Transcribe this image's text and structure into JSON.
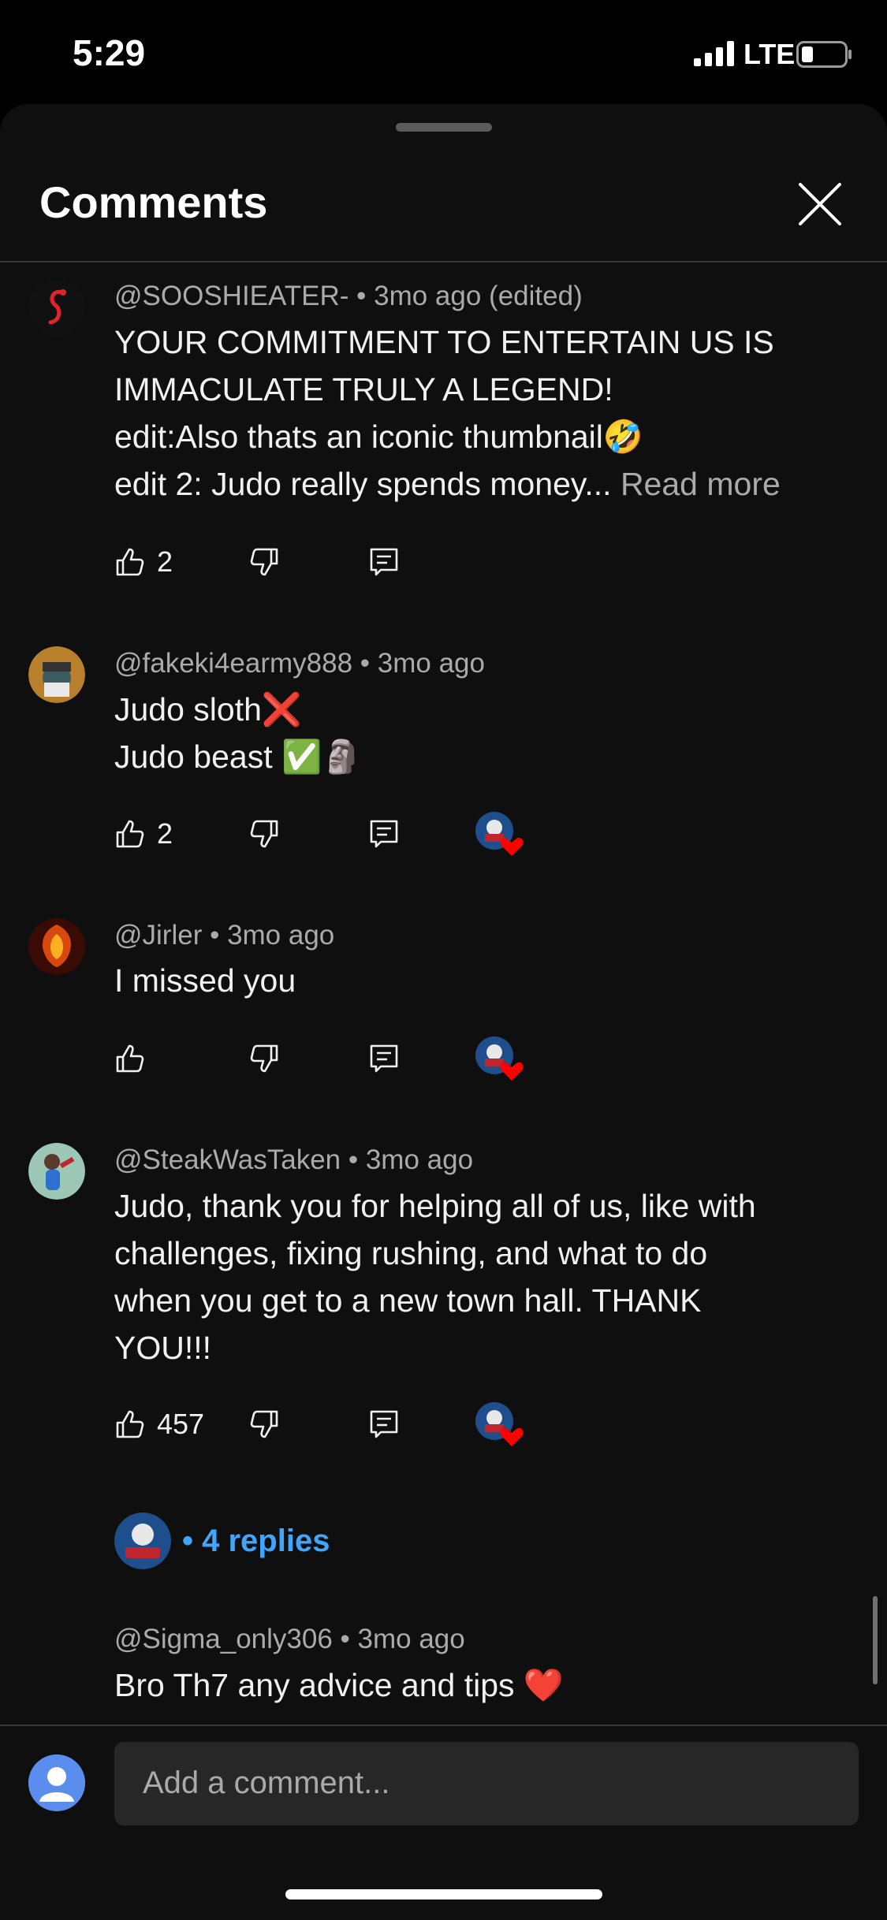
{
  "status": {
    "time": "5:29",
    "network": "LTE"
  },
  "sheet": {
    "title": "Comments"
  },
  "comments": [
    {
      "author": "@SOOSHIEATER-",
      "time": "3mo ago (edited)",
      "lines": [
        "YOUR COMMITMENT TO ENTERTAIN US IS",
        "IMMACULATE TRULY A LEGEND!",
        "edit:Also thats an iconic thumbnail🤣",
        "edit 2: Judo really spends money..."
      ],
      "read_more": "Read more",
      "likes": "2"
    },
    {
      "author": "@fakeki4earmy888",
      "time": "3mo ago",
      "lines": [
        "Judo sloth❌",
        "Judo beast ✅🗿"
      ],
      "likes": "2"
    },
    {
      "author": "@Jirler",
      "time": "3mo ago",
      "lines": [
        "I missed you"
      ],
      "likes": ""
    },
    {
      "author": "@SteakWasTaken",
      "time": "3mo ago",
      "lines": [
        "Judo, thank you for helping all of us, like with",
        "challenges, fixing rushing, and what to do",
        "when you get to a new town hall. THANK",
        "YOU!!!"
      ],
      "likes": "457",
      "replies": "• 4 replies"
    },
    {
      "author": "@Sigma_only306",
      "time": "3mo ago",
      "lines": [
        "Bro Th7 any advice and tips ❤️"
      ]
    }
  ],
  "input": {
    "placeholder": "Add a comment..."
  },
  "colors": {
    "background": "#0f0f0f",
    "link": "#3ea6ff",
    "heart": "#ff0000"
  }
}
